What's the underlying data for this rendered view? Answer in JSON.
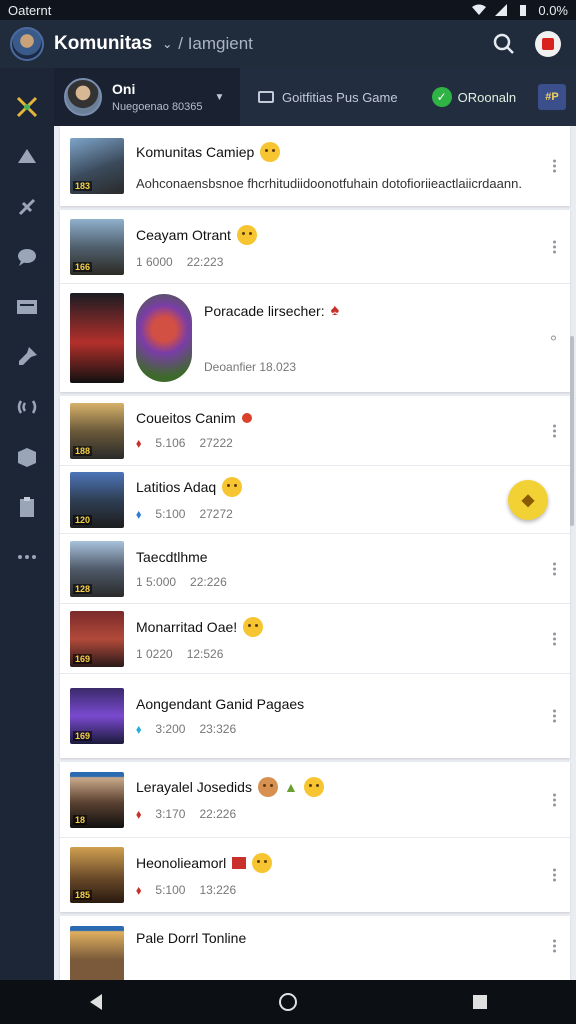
{
  "status_bar": {
    "carrier": "Oaternt",
    "battery": "0.0%"
  },
  "app_bar": {
    "title": "Komunitas",
    "subtitle": "/ Iamgient"
  },
  "sub_header": {
    "profile_name": "Oni",
    "profile_meta": "Nuegoenao 80365",
    "link_label": "Goitfitias Pus Game",
    "online_label": "ORoonaln",
    "badge": "#P"
  },
  "feed": {
    "posts": [
      {
        "title": "Komunitas Camiep",
        "desc": "Aohconaensbsnoe fhcrhitudiidoonotfuhain dotofioriieactlaiicrdaann.",
        "tag": "183"
      },
      {
        "title": "Ceayam Otrant",
        "a": "1 6000",
        "b": "22:223",
        "tag": "166"
      },
      {
        "title": "Poracade lirsecher:",
        "sub": "Deoanfier 18.023"
      },
      {
        "title": "Coueitos Canim",
        "a": "5.106",
        "b": "27222",
        "tag": "188"
      },
      {
        "title": "Latitios Adaq",
        "a": "5:100",
        "b": "27272",
        "tag": "120"
      },
      {
        "title": "Taecdtlhme",
        "a": "1 5:000",
        "b": "22:226",
        "tag": "128"
      },
      {
        "title": "Monarritad Oae!",
        "a": "1 0220",
        "b": "12:526",
        "tag": "169"
      },
      {
        "title": "Aongendant Ganid Pagaes",
        "a": "3:200",
        "b": "23:326",
        "tag": "169"
      },
      {
        "title": "Lerayalel Josedids",
        "a": "3:170",
        "b": "22:226",
        "tag": "18"
      },
      {
        "title": "Heonolieamorl",
        "a": "5:100",
        "b": "13:226",
        "tag": "185"
      },
      {
        "title": "Pale Dorrl Tonline"
      }
    ]
  },
  "colors": {
    "accent": "#2fb344",
    "fab": "#f1d133",
    "bar": "#202b3c"
  }
}
